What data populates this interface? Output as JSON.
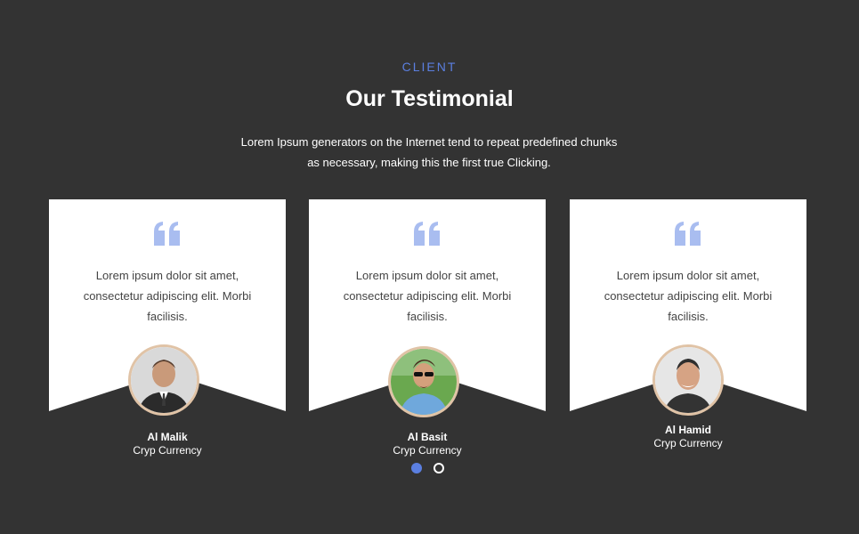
{
  "header": {
    "eyebrow": "CLIENT",
    "title": "Our Testimonial",
    "description": "Lorem Ipsum generators on the Internet tend to repeat predefined chunks as necessary, making this the first true Clicking."
  },
  "testimonials": [
    {
      "text": "Lorem ipsum dolor sit amet, consectetur adipiscing elit. Morbi facilisis.",
      "name": "Al Malik",
      "role": "Cryp Currency",
      "icon": "quote-icon"
    },
    {
      "text": "Lorem ipsum dolor sit amet, consectetur adipiscing elit. Morbi facilisis.",
      "name": "Al Basit",
      "role": "Cryp Currency",
      "icon": "quote-icon"
    },
    {
      "text": "Lorem ipsum dolor sit amet, consectetur adipiscing elit. Morbi facilisis.",
      "name": "Al Hamid",
      "role": "Cryp Currency",
      "icon": "quote-icon"
    }
  ],
  "carousel": {
    "pages": 2,
    "active": 1
  },
  "colors": {
    "accent": "#5b7fe0",
    "quote": "#a9bdf0",
    "background": "#333333",
    "card": "#ffffff",
    "avatar_ring": "#e0c3a6"
  }
}
